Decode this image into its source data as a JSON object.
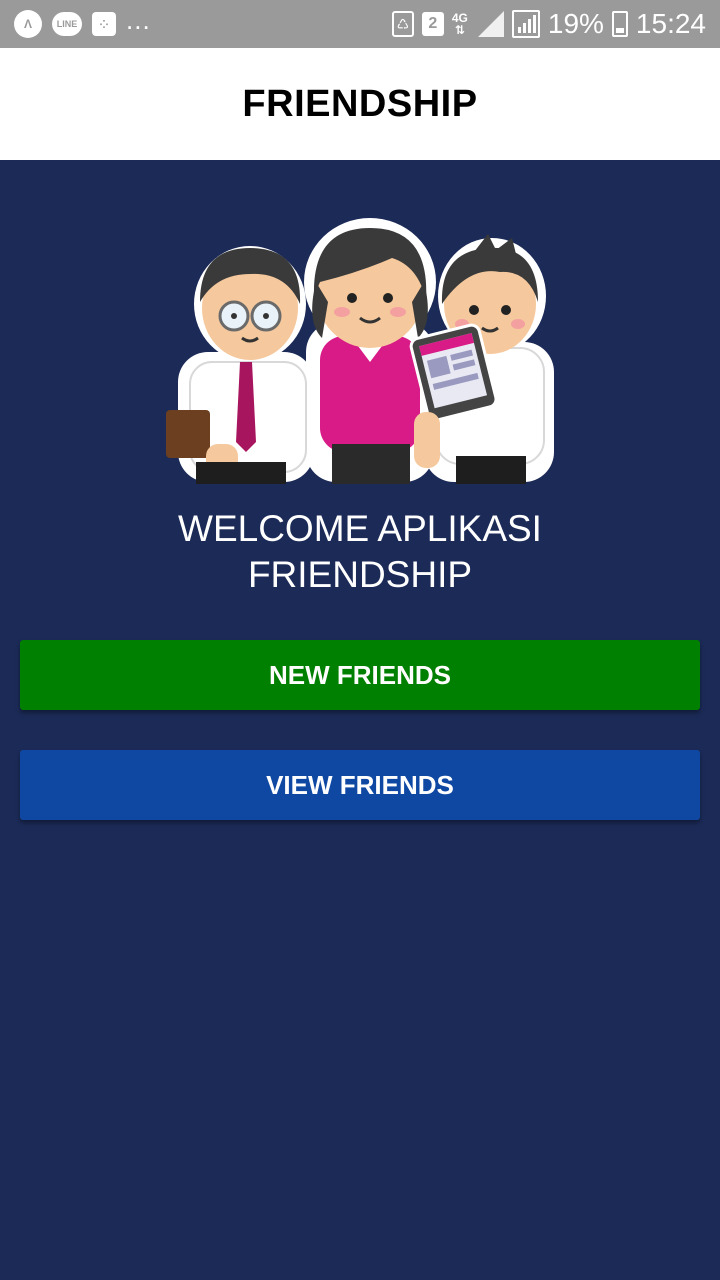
{
  "status_bar": {
    "icons_left": [
      "nearby-icon",
      "line-icon",
      "bbm-icon"
    ],
    "line_label": "LINE",
    "more": "...",
    "sim_badge": "2",
    "network": "4G",
    "battery_percent": "19%",
    "time": "15:24"
  },
  "app_bar": {
    "title": "FRIENDSHIP"
  },
  "illustration": {
    "icon": "three-students-illustration"
  },
  "main": {
    "welcome_line1": "WELCOME APLIKASI",
    "welcome_line2": "FRIENDSHIP",
    "new_friends_label": "NEW FRIENDS",
    "view_friends_label": "VIEW FRIENDS"
  },
  "colors": {
    "background": "#1b2a57",
    "app_bar": "#ffffff",
    "status_bar": "#9a9a9a",
    "new_friends_button": "#008000",
    "view_friends_button": "#0f48a3"
  }
}
